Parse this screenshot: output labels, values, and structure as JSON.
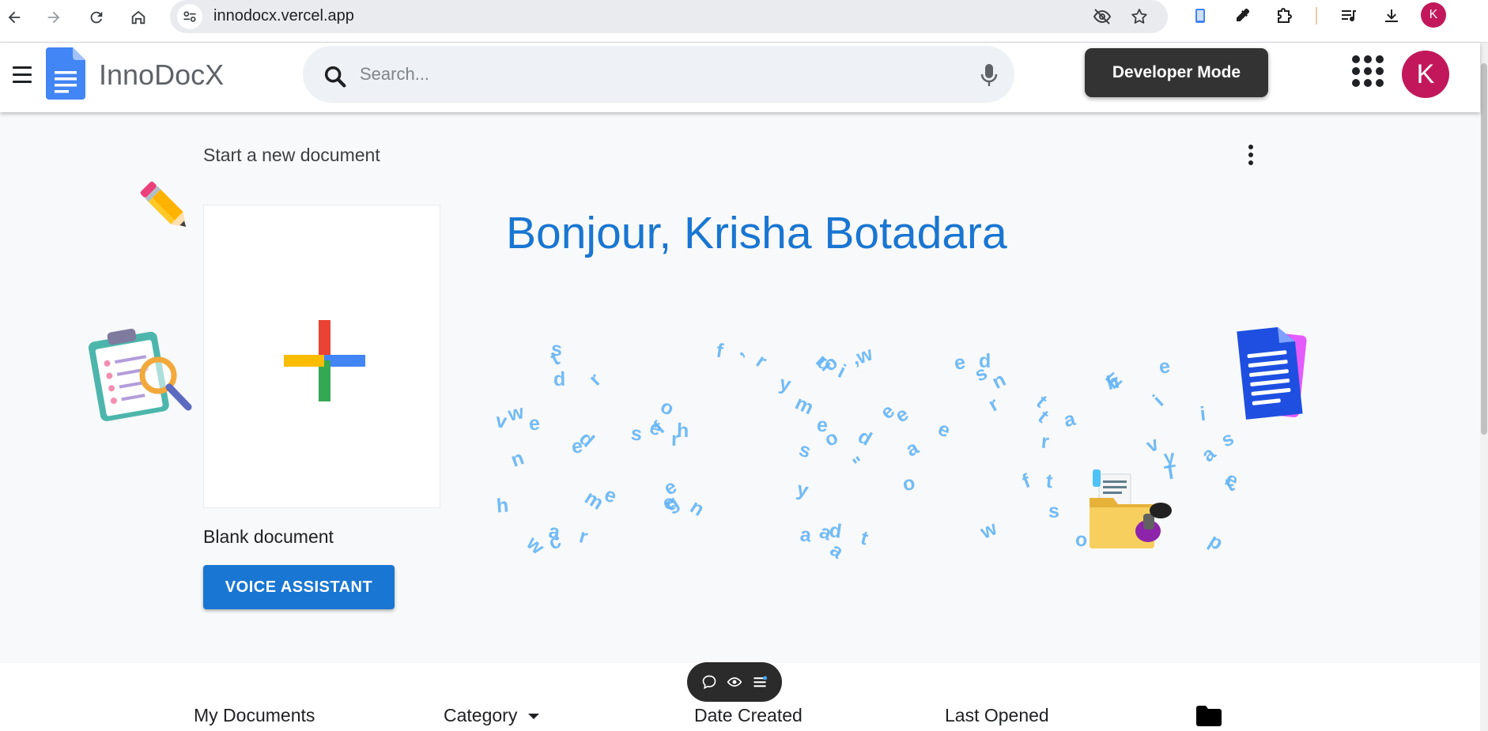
{
  "browser": {
    "url": "innodocx.vercel.app",
    "profile_initial": "K"
  },
  "header": {
    "app_name": "InnoDocX",
    "search_placeholder": "Search...",
    "developer_mode_label": "Developer Mode",
    "avatar_initial": "K"
  },
  "hero": {
    "start_label": "Start a new document",
    "blank_label": "Blank document",
    "voice_button": "VOICE ASSISTANT",
    "greeting": "Bonjour, Krisha Botadara",
    "scatter_letters": [
      "\"",
      "r",
      "a",
      "m",
      "d",
      "e",
      "a",
      "w",
      "d",
      "s",
      "r",
      "s",
      "e",
      "a",
      "c",
      "v",
      "e",
      "s",
      "o",
      "y",
      "i",
      "d",
      "o",
      "g",
      "n",
      "p",
      "t",
      "w",
      "e",
      "t",
      "v",
      "u",
      "d",
      "i",
      "i",
      "e",
      "w",
      "E",
      "s",
      "e",
      "w",
      ",",
      "o",
      "r",
      "e",
      "e",
      "h",
      "t",
      "f",
      "r",
      "t",
      "f",
      "e",
      "y",
      "r",
      "t",
      "a",
      "s",
      "o",
      "e",
      "r",
      "o",
      "s",
      "a",
      "e",
      "t",
      "n",
      "e",
      "a",
      "y",
      "e",
      "T",
      "h",
      "a",
      "d",
      "h",
      ",",
      "r",
      "e",
      "f",
      "m",
      "n"
    ]
  },
  "chat_pill": {
    "icons": [
      "chat-bubble-icon",
      "eye-icon",
      "list-icon"
    ]
  },
  "documents": {
    "columns": [
      "My Documents",
      "Category",
      "Date Created",
      "Last Opened"
    ]
  },
  "colors": {
    "brand_blue": "#1976d2",
    "developer_button": "#333333",
    "avatar": "#c2185b",
    "letters": "#64b5f6"
  }
}
